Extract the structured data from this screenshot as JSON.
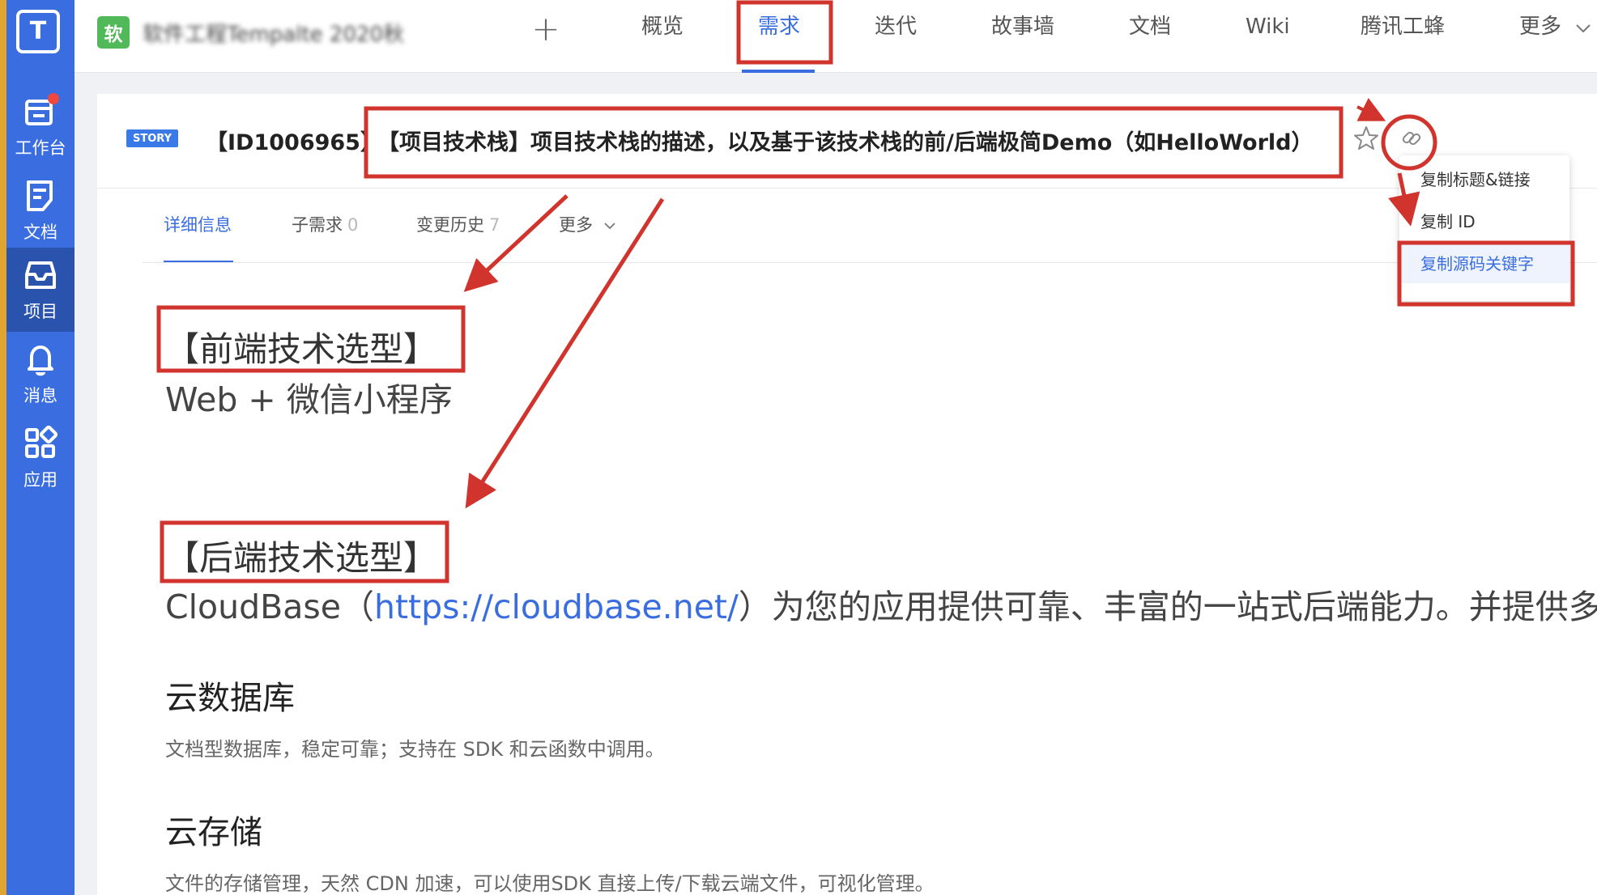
{
  "sidebar": {
    "logo_char": "T",
    "items": [
      {
        "label": "工作台",
        "icon": "workbench-icon"
      },
      {
        "label": "文档",
        "icon": "document-icon"
      },
      {
        "label": "项目",
        "icon": "project-icon",
        "active": true
      },
      {
        "label": "消息",
        "icon": "bell-icon"
      },
      {
        "label": "应用",
        "icon": "apps-icon"
      }
    ]
  },
  "topbar": {
    "project_badge": "软",
    "project_name": "软件工程Tempalte 2020秋",
    "tabs": [
      "概览",
      "需求",
      "迭代",
      "故事墙",
      "文档",
      "Wiki",
      "腾讯工蜂",
      "更多"
    ],
    "active_tab": "需求"
  },
  "story": {
    "tag": "STORY",
    "id": "【ID1006965】",
    "title": "【项目技术栈】项目技术栈的描述，以及基于该技术栈的前/后端极简Demo（如HelloWorld）"
  },
  "subtabs": [
    {
      "label": "详细信息",
      "count": ""
    },
    {
      "label": "子需求",
      "count": "0"
    },
    {
      "label": "变更历史",
      "count": "7"
    },
    {
      "label": "更多",
      "count": ""
    }
  ],
  "dropdown": {
    "items": [
      "复制标题&链接",
      "复制 ID",
      "复制源码关键字"
    ],
    "highlighted": "复制源码关键字"
  },
  "content": {
    "frontend_heading": "【前端技术选型】",
    "frontend_text": "Web + 微信小程序",
    "backend_heading": "【后端技术选型】",
    "backend_prefix": "CloudBase（",
    "backend_link": "https://cloudbase.net/",
    "backend_suffix": "）为您的应用提供可靠、丰富的一站式后端能力。并提供多",
    "db_heading": "云数据库",
    "db_text": "文档型数据库，稳定可靠；支持在 SDK 和云函数中调用。",
    "storage_heading": "云存储",
    "storage_text": "文件的存储管理，天然 CDN 加速，可以使用SDK 直接上传/下载云端文件，可视化管理。"
  },
  "colors": {
    "sidebar": "#3a6ee0",
    "accent": "#3a6ee0",
    "annotation": "#d0342c",
    "badge_green": "#52b95a"
  }
}
